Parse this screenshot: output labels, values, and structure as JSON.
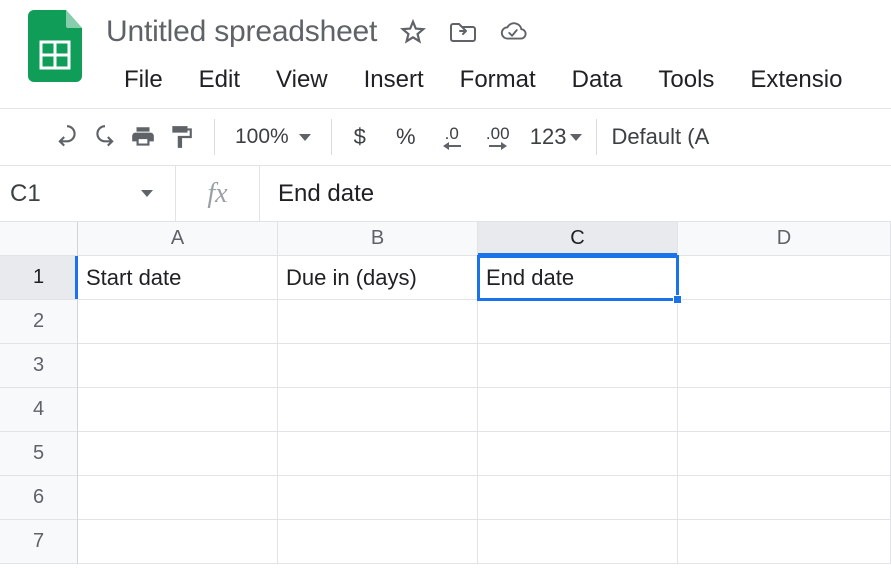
{
  "header": {
    "doc_title": "Untitled spreadsheet"
  },
  "menu": {
    "file": "File",
    "edit": "Edit",
    "view": "View",
    "insert": "Insert",
    "format": "Format",
    "data": "Data",
    "tools": "Tools",
    "extensions": "Extensio"
  },
  "toolbar": {
    "zoom": "100%",
    "currency": "$",
    "percent": "%",
    "dec_decrease": ".0",
    "dec_increase": ".00",
    "format_123": "123",
    "font": "Default (A"
  },
  "formula_bar": {
    "namebox": "C1",
    "fx_label": "fx",
    "value": "End date"
  },
  "columns": [
    "A",
    "B",
    "C",
    "D"
  ],
  "rows": [
    "1",
    "2",
    "3",
    "4",
    "5",
    "6",
    "7"
  ],
  "selected_cell": "C1",
  "cells": {
    "A1": "Start date",
    "B1": "Due in (days)",
    "C1": "End date"
  }
}
